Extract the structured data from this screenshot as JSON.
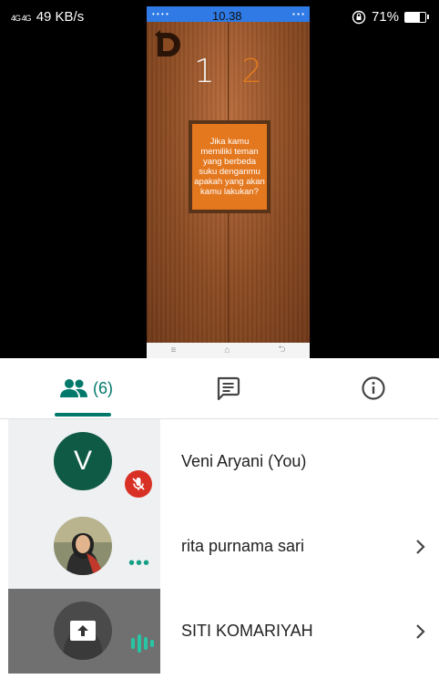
{
  "status_bar": {
    "signal": "4G 4G",
    "speed": "49 KB/s",
    "battery": "71%",
    "battery_level": 0.71
  },
  "shared_screen": {
    "time": "10.38",
    "player_one": "1",
    "player_two": "2",
    "question": "Jika kamu memiliki teman yang berbeda suku denganmu apakah yang akan kamu lakukan?"
  },
  "tabs": {
    "people_count": "(6)"
  },
  "participants": [
    {
      "initial": "V",
      "name": "Veni Aryani (You)"
    },
    {
      "name": "rita purnama sari"
    },
    {
      "name": "SITI KOMARIYAH"
    }
  ],
  "colors": {
    "accent": "#00796b",
    "avatar_bg": "#0f5a44",
    "mute_red": "#d93025",
    "talk_green": "#26c6a4",
    "game_orange": "#e4781f"
  }
}
